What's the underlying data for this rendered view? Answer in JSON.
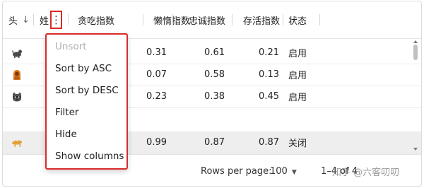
{
  "grid": {
    "columns": [
      {
        "label": "头"
      },
      {
        "label": "姓"
      },
      {
        "label": "贪吃指数"
      },
      {
        "label": "懒惰指数"
      },
      {
        "label": "忠诚指数"
      },
      {
        "label": "存活指数"
      },
      {
        "label": "状态"
      }
    ],
    "sort_indicator": "↓",
    "column_menu_glyph": "⋮",
    "rows": [
      {
        "avatar": "animal-1-icon",
        "gluttony": "",
        "laziness": "0.31",
        "loyalty": "0.61",
        "survival": "0.21",
        "status": "启用"
      },
      {
        "avatar": "animal-2-icon",
        "gluttony": "",
        "laziness": "0.07",
        "loyalty": "0.58",
        "survival": "0.13",
        "status": "启用"
      },
      {
        "avatar": "animal-3-icon",
        "gluttony": "",
        "laziness": "0.23",
        "loyalty": "0.38",
        "survival": "0.45",
        "status": "启用"
      },
      {
        "avatar": "animal-4-icon",
        "gluttony": "",
        "laziness": "0.99",
        "loyalty": "0.87",
        "survival": "0.87",
        "status": "关闭"
      }
    ]
  },
  "column_menu": {
    "items": [
      {
        "label": "Unsort",
        "disabled": true
      },
      {
        "label": "Sort by ASC",
        "disabled": false
      },
      {
        "label": "Sort by DESC",
        "disabled": false
      },
      {
        "label": "Filter",
        "disabled": false
      },
      {
        "label": "Hide",
        "disabled": false
      },
      {
        "label": "Show columns",
        "disabled": false
      }
    ]
  },
  "footer": {
    "rows_per_page_label": "Rows per page:",
    "rows_per_page_value": "100",
    "range_text": "1–4 of 4"
  },
  "watermark": "知乎 @六客叨叨",
  "colors": {
    "highlight_border": "#d92b2b",
    "row_hover": "#eeeeee"
  }
}
